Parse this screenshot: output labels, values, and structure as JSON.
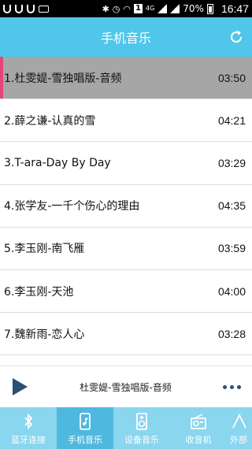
{
  "status_bar": {
    "signal_label": "4G",
    "num_badge": "1",
    "battery": "70%",
    "time": "16:47"
  },
  "header": {
    "title": "手机音乐"
  },
  "songs": [
    {
      "title": "1.杜雯媞-雪独唱版-音频",
      "duration": "03:50",
      "active": true
    },
    {
      "title": "2.薛之谦-认真的雪",
      "duration": "04:21"
    },
    {
      "title": "3.T-ara-Day By Day",
      "duration": "03:29"
    },
    {
      "title": "4.张学友-一千个伤心的理由",
      "duration": "04:35"
    },
    {
      "title": "5.李玉刚-南飞雁",
      "duration": "03:59"
    },
    {
      "title": "6.李玉刚-天池",
      "duration": "04:00"
    },
    {
      "title": "7.魏新雨-恋人心",
      "duration": "03:28"
    }
  ],
  "player": {
    "now_playing": "杜雯媞-雪独唱版-音频"
  },
  "nav": [
    {
      "label": "蓝牙连接",
      "icon": "bluetooth-icon"
    },
    {
      "label": "手机音乐",
      "icon": "phone-music-icon",
      "active": true
    },
    {
      "label": "设备音乐",
      "icon": "speaker-icon"
    },
    {
      "label": "收音机",
      "icon": "radio-icon"
    },
    {
      "label": "外部",
      "icon": "external-icon"
    }
  ],
  "colors": {
    "accent": "#4fc6ea",
    "nav_bg": "#8ad6ef",
    "active_row": "#a6a6a6",
    "active_marker": "#e0457b"
  }
}
